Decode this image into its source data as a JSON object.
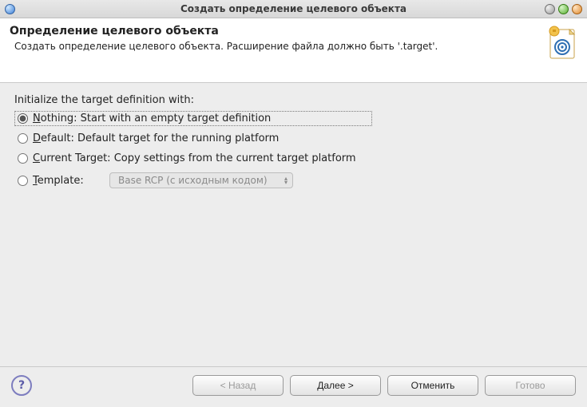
{
  "window": {
    "title": "Создать определение целевого объекта"
  },
  "banner": {
    "heading": "Определение целевого объекта",
    "description": "Создать определение целевого объекта.  Расширение файла должно быть '.target'."
  },
  "content": {
    "prompt": "Initialize the target definition with:",
    "options": {
      "nothing": {
        "prefix": "",
        "mnemonic": "N",
        "suffix": "othing: Start with an empty target definition",
        "selected": true
      },
      "default": {
        "prefix": "",
        "mnemonic": "D",
        "suffix": "efault: Default target for the running platform",
        "selected": false
      },
      "current": {
        "prefix": "",
        "mnemonic": "C",
        "suffix": "urrent Target: Copy settings from the current target platform",
        "selected": false
      },
      "template": {
        "prefix": "",
        "mnemonic": "T",
        "suffix": "emplate:",
        "selected": false,
        "combo_value": "Base RCP (с исходным кодом)",
        "combo_enabled": false
      }
    }
  },
  "footer": {
    "help": "?",
    "back": "< Назад",
    "next": "Далее >",
    "cancel": "Отменить",
    "finish": "Готово",
    "back_enabled": false,
    "next_enabled": true,
    "cancel_enabled": true,
    "finish_enabled": false
  }
}
